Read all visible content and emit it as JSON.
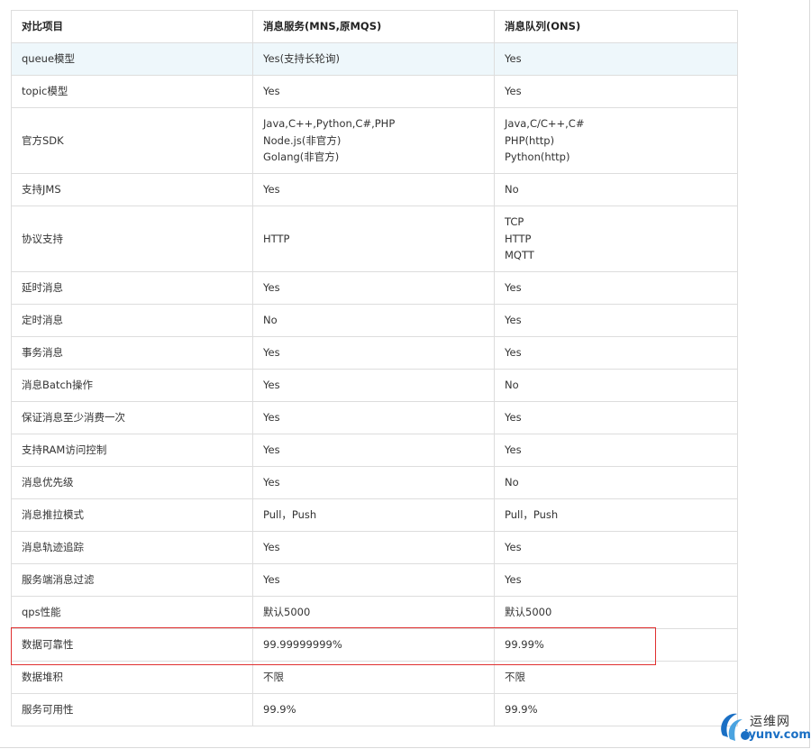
{
  "table": {
    "headers": [
      "对比项目",
      "消息服务(MNS,原MQS)",
      "消息队列(ONS)"
    ],
    "rows": [
      {
        "item": "queue模型",
        "mns": [
          "Yes(支持长轮询)"
        ],
        "ons": [
          "Yes"
        ]
      },
      {
        "item": "topic模型",
        "mns": [
          "Yes"
        ],
        "ons": [
          "Yes"
        ]
      },
      {
        "item": "官方SDK",
        "mns": [
          "Java,C++,Python,C#,PHP",
          "Node.js(非官方)",
          "Golang(非官方)"
        ],
        "ons": [
          "Java,C/C++,C#",
          "PHP(http)",
          "Python(http)"
        ]
      },
      {
        "item": "支持JMS",
        "mns": [
          "Yes"
        ],
        "ons": [
          "No"
        ]
      },
      {
        "item": "协议支持",
        "mns": [
          "HTTP"
        ],
        "ons": [
          "TCP",
          "HTTP",
          "MQTT"
        ]
      },
      {
        "item": "延时消息",
        "mns": [
          "Yes"
        ],
        "ons": [
          "Yes"
        ]
      },
      {
        "item": "定时消息",
        "mns": [
          "No"
        ],
        "ons": [
          "Yes"
        ]
      },
      {
        "item": "事务消息",
        "mns": [
          "Yes"
        ],
        "ons": [
          "Yes"
        ]
      },
      {
        "item": "消息Batch操作",
        "mns": [
          "Yes"
        ],
        "ons": [
          "No"
        ]
      },
      {
        "item": "保证消息至少消费一次",
        "mns": [
          "Yes"
        ],
        "ons": [
          "Yes"
        ]
      },
      {
        "item": "支持RAM访问控制",
        "mns": [
          "Yes"
        ],
        "ons": [
          "Yes"
        ]
      },
      {
        "item": "消息优先级",
        "mns": [
          "Yes"
        ],
        "ons": [
          "No"
        ]
      },
      {
        "item": "消息推拉模式",
        "mns": [
          "Pull，Push"
        ],
        "ons": [
          "Pull，Push"
        ]
      },
      {
        "item": "消息轨迹追踪",
        "mns": [
          "Yes"
        ],
        "ons": [
          "Yes"
        ]
      },
      {
        "item": "服务端消息过滤",
        "mns": [
          "Yes"
        ],
        "ons": [
          "Yes"
        ]
      },
      {
        "item": "qps性能",
        "mns": [
          "默认5000"
        ],
        "ons": [
          "默认5000"
        ]
      },
      {
        "item": "数据可靠性",
        "mns": [
          "99.99999999%"
        ],
        "ons": [
          "99.99%"
        ]
      },
      {
        "item": "数据堆积",
        "mns": [
          "不限"
        ],
        "ons": [
          "不限"
        ]
      },
      {
        "item": "服务可用性",
        "mns": [
          "99.9%"
        ],
        "ons": [
          "99.9%"
        ]
      }
    ]
  },
  "watermark": {
    "cn": "运维网",
    "en": "iyunv.com"
  },
  "colors": {
    "highlight_border": "#e03030",
    "hover_row": "#eef7fb",
    "grid": "#dddddd",
    "watermark_blue": "#1a6fc4"
  }
}
